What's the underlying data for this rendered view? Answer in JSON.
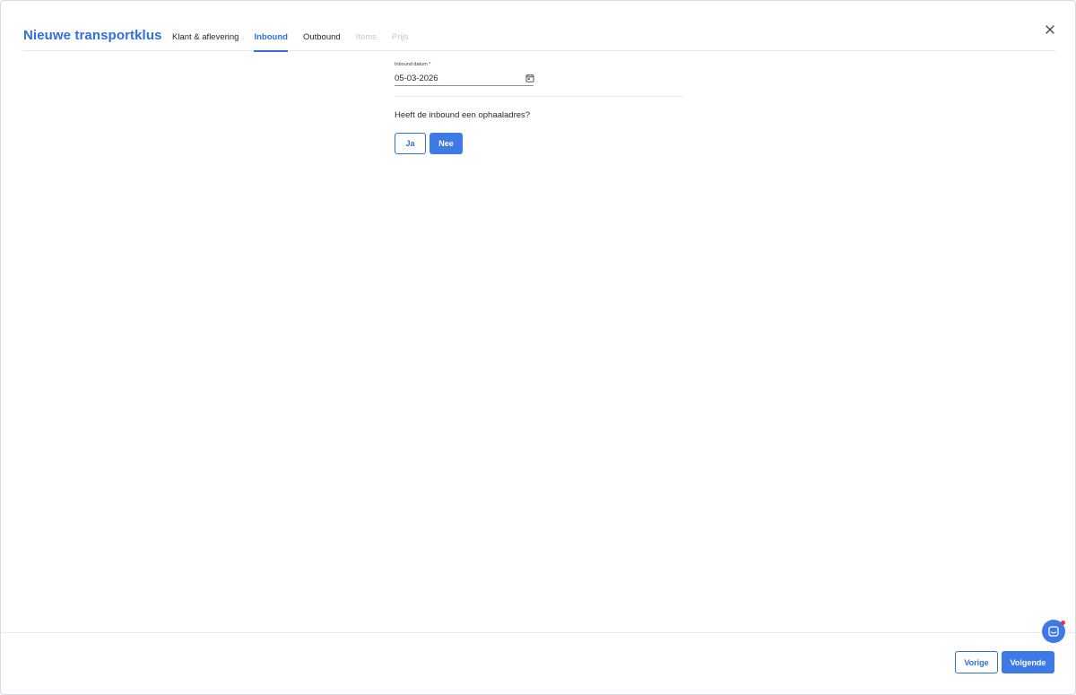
{
  "modal": {
    "title": "Nieuwe transportklus",
    "close_icon": "close-icon"
  },
  "tabs": [
    {
      "label": "Klant & aflevering",
      "state": "default"
    },
    {
      "label": "Inbound",
      "state": "active"
    },
    {
      "label": "Outbound",
      "state": "default"
    },
    {
      "label": "Items",
      "state": "disabled"
    },
    {
      "label": "Prijs",
      "state": "disabled"
    }
  ],
  "form": {
    "date_label": "Inbound datum *",
    "date_value": "05-03-2026",
    "calendar_icon": "calendar-icon",
    "question": "Heeft de inbound een ophaaladres?",
    "yes_label": "Ja",
    "no_label": "Nee",
    "selected": "Nee"
  },
  "footer": {
    "prev_label": "Vorige",
    "next_label": "Volgende"
  },
  "chat": {
    "icon": "chat-icon",
    "has_notification": true
  },
  "colors": {
    "accent": "#2f6fdf",
    "button_fill": "#3d7ae6",
    "disabled_text": "#c5c8ce",
    "notification": "#e0324b"
  }
}
